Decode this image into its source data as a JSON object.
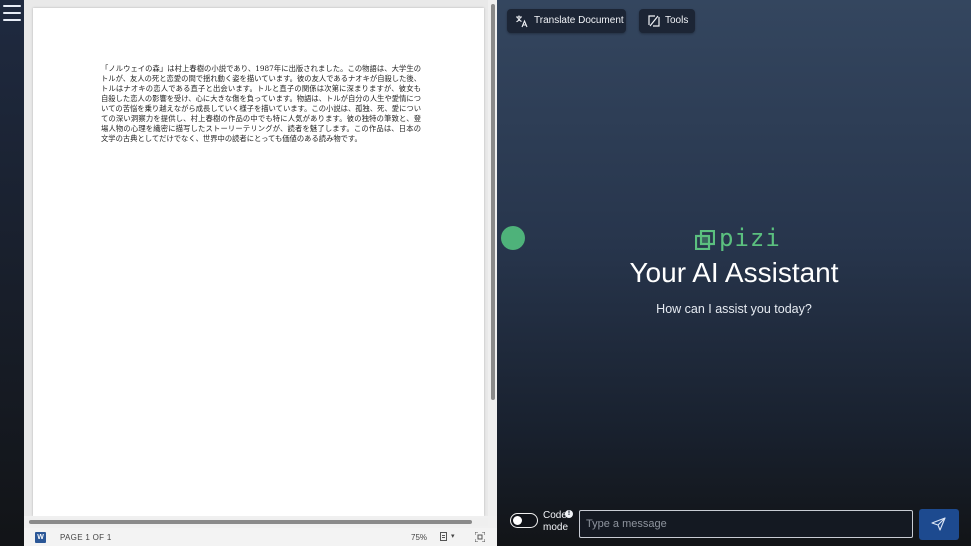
{
  "document": {
    "body_text": "「ノルウェイの森」は村上春樹の小説であり、1987年に出版されました。この物語は、大学生のトルが、友人の死と恋愛の間で揺れ動く姿を描いています。彼の友人であるナオキが自殺した後、トルはナオキの恋人である直子と出会います。トルと直子の関係は次第に深まりますが、彼女も自殺した恋人の影響を受け、心に大きな傷を負っています。物語は、トルが自分の人生や愛情についての苦悩を乗り越えながら成長していく様子を描いています。この小説は、孤独、死、愛についての深い洞察力を提供し、村上春樹の作品の中でも特に人気があります。彼の独特の筆致と、登場人物の心理を繊密に描写したストーリーテリングが、読者を魅了します。この作品は、日本の文学の古典としてだけでなく、世界中の読者にとっても価値のある読み物です。"
  },
  "statusbar": {
    "word_icon_letter": "W",
    "page_count": "PAGE 1 OF 1",
    "zoom": "75%",
    "caret": "▾"
  },
  "toolbar": {
    "translate_label": "Translate Document",
    "tools_label": "Tools"
  },
  "assistant": {
    "brand_name": "pizi",
    "headline": "Your AI Assistant",
    "subline": "How can I assist you today?",
    "code_mode_label": "Code mode",
    "info_badge": "!",
    "message_placeholder": "Type a message"
  },
  "colors": {
    "brand_green": "#5bc07f",
    "dot_green": "#4eb27a",
    "send_blue": "#1d4a8f"
  },
  "icons": [
    "hamburger-menu-icon",
    "word-document-icon",
    "page-view-icon",
    "fit-page-icon",
    "translate-icon",
    "tools-icon",
    "pizi-logo-icon",
    "send-icon"
  ]
}
